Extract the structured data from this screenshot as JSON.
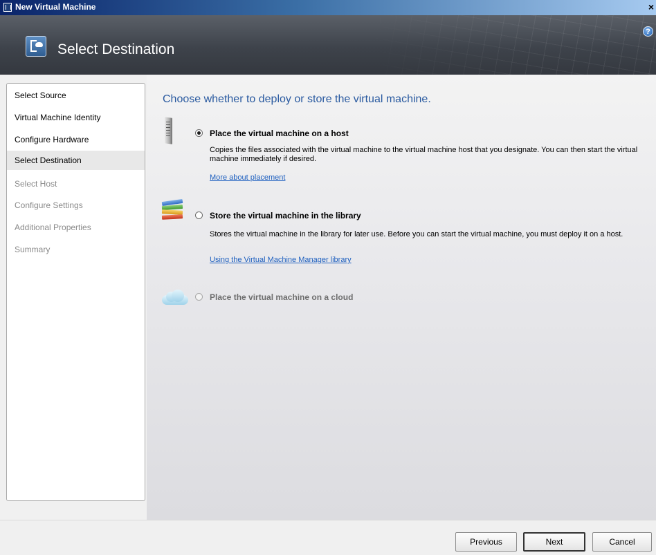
{
  "window": {
    "title": "New Virtual Machine",
    "close_glyph": "×"
  },
  "header": {
    "page_title": "Select Destination",
    "help_glyph": "?"
  },
  "nav": {
    "items": [
      {
        "label": "Select Source",
        "state": "enabled"
      },
      {
        "label": "Virtual Machine Identity",
        "state": "enabled"
      },
      {
        "label": "Configure Hardware",
        "state": "enabled"
      },
      {
        "label": "Select Destination",
        "state": "active"
      },
      {
        "label": "Select Host",
        "state": "disabled"
      },
      {
        "label": "Configure Settings",
        "state": "disabled"
      },
      {
        "label": "Additional Properties",
        "state": "disabled"
      },
      {
        "label": "Summary",
        "state": "disabled"
      }
    ]
  },
  "main": {
    "heading": "Choose whether to deploy or store the virtual machine.",
    "options": [
      {
        "label": "Place the virtual machine on a host",
        "selected": true,
        "enabled": true,
        "icon": "server-icon",
        "description": "Copies the files associated with the virtual machine to the virtual machine host that you designate.  You can then start the virtual machine immediately if desired.",
        "link": "More about placement"
      },
      {
        "label": "Store the virtual machine in the library",
        "selected": false,
        "enabled": true,
        "icon": "library-books-icon",
        "description": "Stores the virtual machine in the library for later use. Before you can start the virtual machine, you must deploy it on a host.",
        "link": "Using the Virtual Machine Manager library"
      },
      {
        "label": "Place the virtual machine on a cloud",
        "selected": false,
        "enabled": false,
        "icon": "cloud-icon"
      }
    ]
  },
  "footer": {
    "previous_label": "Previous",
    "next_label": "Next",
    "cancel_label": "Cancel"
  },
  "colors": {
    "heading": "#2a5aa0",
    "link": "#1d5fbf",
    "header_bg": "#3e434b",
    "title_bar": "#0a246a"
  }
}
